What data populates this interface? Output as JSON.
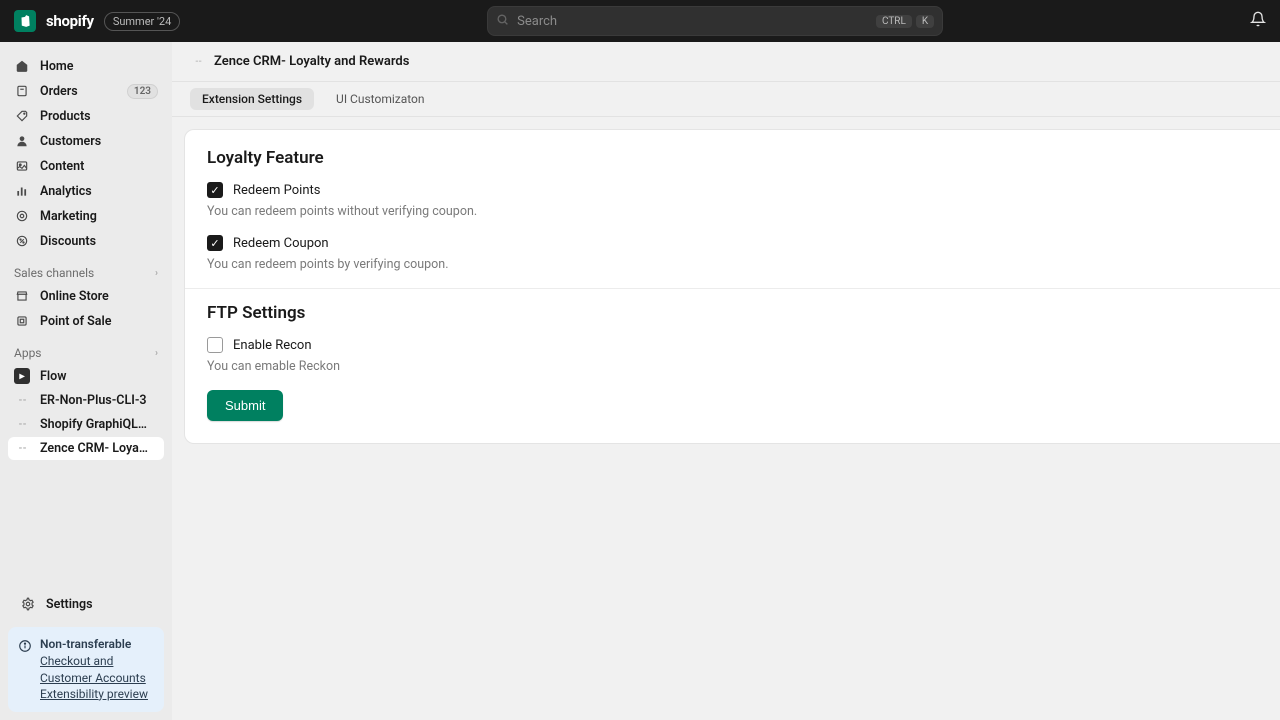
{
  "topbar": {
    "brand": "shopify",
    "summer": "Summer '24",
    "search_placeholder": "Search",
    "kbd1": "CTRL",
    "kbd2": "K"
  },
  "sidebar": {
    "nav": {
      "home": "Home",
      "orders": "Orders",
      "orders_badge": "123",
      "products": "Products",
      "customers": "Customers",
      "content": "Content",
      "analytics": "Analytics",
      "marketing": "Marketing",
      "discounts": "Discounts"
    },
    "sales_header": "Sales channels",
    "online_store": "Online Store",
    "pos": "Point of Sale",
    "apps_header": "Apps",
    "apps": {
      "flow": "Flow",
      "er": "ER-Non-Plus-CLI-3",
      "graphiql": "Shopify GraphiQL App",
      "zence": "Zence CRM- Loyalty and ..."
    },
    "settings": "Settings",
    "notice_title": "Non-transferable",
    "notice_body": "Checkout and Customer Accounts Extensibility preview"
  },
  "page": {
    "title": "Zence CRM- Loyalty and Rewards",
    "tab_ext": "Extension Settings",
    "tab_ui": "UI Customizaton",
    "loyalty_title": "Loyalty Feature",
    "redeem_points_label": "Redeem Points",
    "redeem_points_help": "You can redeem points without verifying coupon.",
    "redeem_coupon_label": "Redeem Coupon",
    "redeem_coupon_help": "You can redeem points by verifying coupon.",
    "ftp_title": "FTP Settings",
    "recon_label": "Enable Recon",
    "recon_help": "You can emable Reckon",
    "submit": "Submit"
  }
}
